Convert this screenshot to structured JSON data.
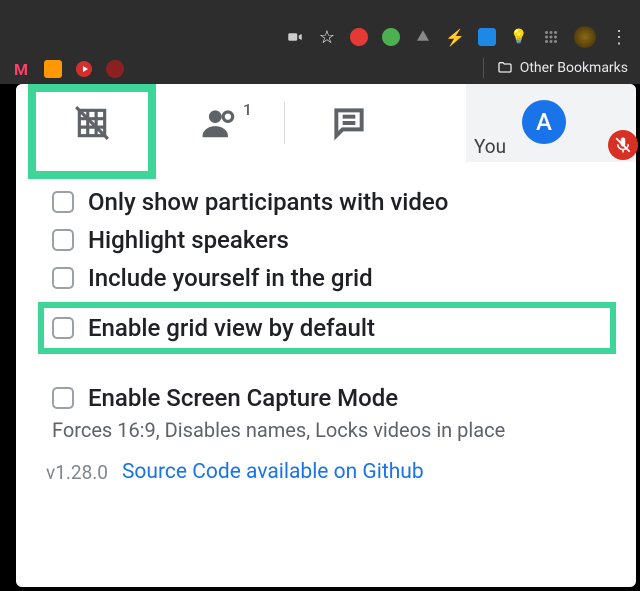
{
  "browser": {
    "bookmarks_label": "Other Bookmarks"
  },
  "tabs": {
    "people_count": "1"
  },
  "tile": {
    "you_label": "You",
    "avatar_initial": "A"
  },
  "options": [
    {
      "label": "Only show participants with video"
    },
    {
      "label": "Highlight speakers"
    },
    {
      "label": "Include yourself in the grid"
    },
    {
      "label": "Enable grid view by default"
    },
    {
      "label": "Enable Screen Capture Mode"
    }
  ],
  "option_sub": "Forces 16:9, Disables names, Locks videos in place",
  "footer": {
    "version": "v1.28.0",
    "link_label": "Source Code available on Github"
  }
}
